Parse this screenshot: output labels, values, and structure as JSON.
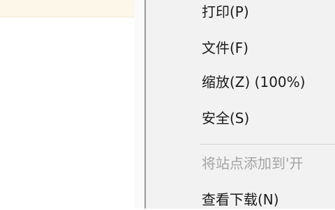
{
  "menu": {
    "items": [
      {
        "label": "打印(P)"
      },
      {
        "label": "文件(F)"
      },
      {
        "label": "缩放(Z) (100%)"
      },
      {
        "label": "安全(S)"
      },
      {
        "label": "将站点添加到'开",
        "disabled": true
      },
      {
        "label": "查看下载(N)"
      }
    ]
  }
}
